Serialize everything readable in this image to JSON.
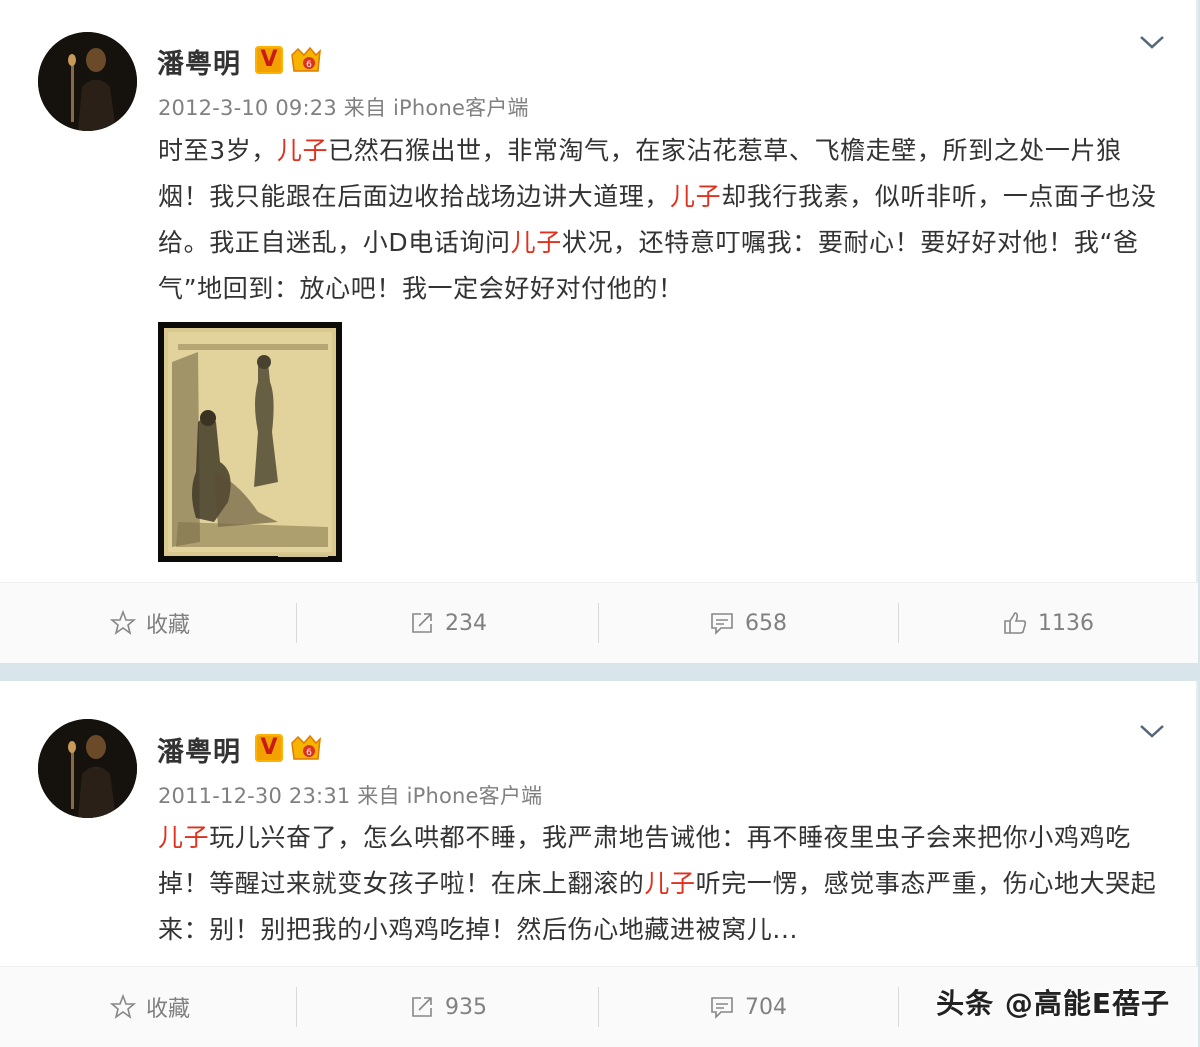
{
  "posts": [
    {
      "author": "潘粤明",
      "verified_badge": "V",
      "meta": "2012-3-10 09:23 来自 iPhone客户端",
      "text_segments": [
        {
          "t": "时至3岁，",
          "hl": false
        },
        {
          "t": "儿子",
          "hl": true
        },
        {
          "t": "已然石猴出世，非常淘气，在家沾花惹草、飞檐走壁，所到之处一片狼烟！我只能跟在后面边收拾战场边讲大道理，",
          "hl": false
        },
        {
          "t": "儿子",
          "hl": true
        },
        {
          "t": "却我行我素，似听非听，一点面子也没给。我正自迷乱，小D电话询问",
          "hl": false
        },
        {
          "t": "儿子",
          "hl": true
        },
        {
          "t": "状况，还特意叮嘱我：要耐心！要好好对他！我“爸气”地回到：放心吧！我一定会好好对付他的！",
          "hl": false
        }
      ],
      "actions": {
        "favorite": "收藏",
        "repost": "234",
        "comment": "658",
        "like": "1136"
      }
    },
    {
      "author": "潘粤明",
      "verified_badge": "V",
      "meta": "2011-12-30 23:31 来自 iPhone客户端",
      "text_segments": [
        {
          "t": "儿子",
          "hl": true
        },
        {
          "t": "玩儿兴奋了，怎么哄都不睡，我严肃地告诫他：再不睡夜里虫子会来把你小鸡鸡吃掉！等醒过来就变女孩子啦！在床上翻滚的",
          "hl": false
        },
        {
          "t": "儿子",
          "hl": true
        },
        {
          "t": "听完一愣，感觉事态严重，伤心地大哭起来：别！别把我的小鸡鸡吃掉！然后伤心地藏进被窝儿...",
          "hl": false
        }
      ],
      "actions": {
        "favorite": "收藏",
        "repost": "935",
        "comment": "704",
        "like": ""
      }
    }
  ],
  "watermark": "头条 @高能E蓓子",
  "colors": {
    "highlight": "#e0301e",
    "meta": "#808080",
    "badge_orange": "#f3a100",
    "page_bg": "#d8e6ec"
  }
}
